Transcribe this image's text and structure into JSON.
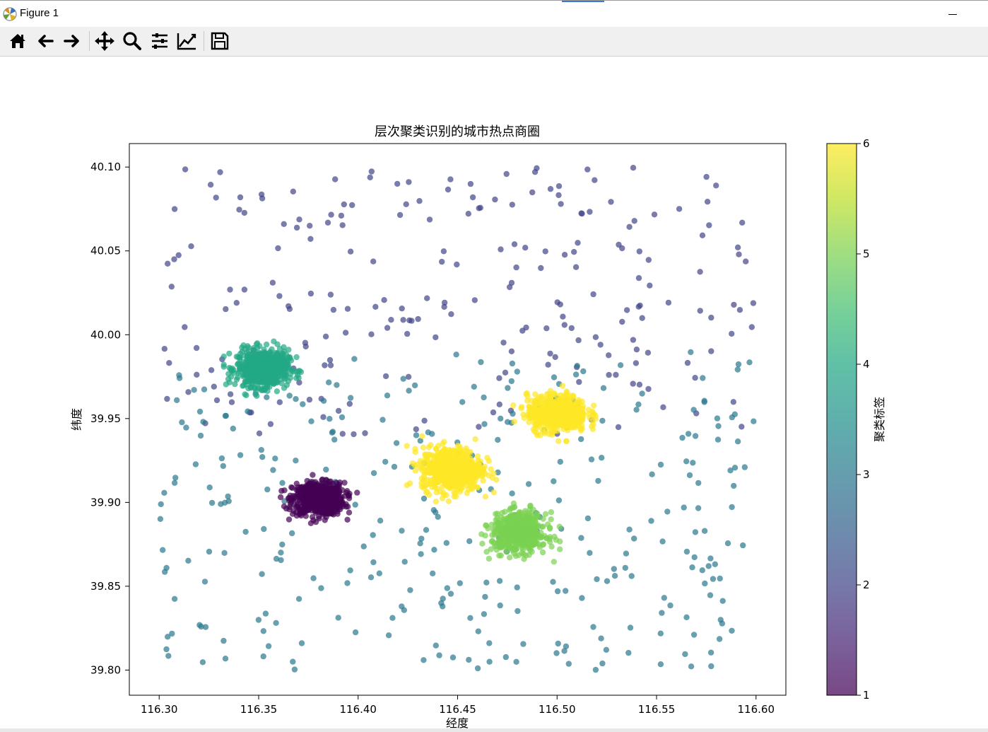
{
  "window": {
    "title": "Figure 1"
  },
  "toolbar": {
    "buttons": [
      {
        "icon": "home-icon"
      },
      {
        "icon": "back-arrow-icon"
      },
      {
        "icon": "forward-arrow-icon"
      },
      {
        "icon": "pan-icon"
      },
      {
        "icon": "zoom-icon"
      },
      {
        "icon": "subplots-config-icon"
      },
      {
        "icon": "edit-axis-icon"
      },
      {
        "icon": "save-icon"
      }
    ]
  },
  "chart_data": {
    "type": "scatter",
    "title": "层次聚类识别的城市热点商圈",
    "xlabel": "经度",
    "ylabel": "纬度",
    "xlim": [
      116.285,
      116.615
    ],
    "ylim": [
      39.785,
      40.114
    ],
    "xticks": [
      116.3,
      116.35,
      116.4,
      116.45,
      116.5,
      116.55,
      116.6
    ],
    "xtick_labels": [
      "116.30",
      "116.35",
      "116.40",
      "116.45",
      "116.50",
      "116.55",
      "116.60"
    ],
    "yticks": [
      39.8,
      39.85,
      39.9,
      39.95,
      40.0,
      40.05,
      40.1
    ],
    "ytick_labels": [
      "39.80",
      "39.85",
      "39.90",
      "39.95",
      "40.00",
      "40.05",
      "40.10"
    ],
    "colorbar": {
      "label": "聚类标签",
      "range": [
        1,
        6
      ],
      "ticks": [
        1,
        2,
        3,
        4,
        5,
        6
      ],
      "tick_labels": [
        "1",
        "2",
        "3",
        "4",
        "5",
        "6"
      ],
      "colormap": "viridis"
    },
    "point_alpha": 0.7,
    "colors": {
      "1": "#440154",
      "2": "#414487",
      "3": "#2a788e",
      "4": "#22a884",
      "5": "#7ad151",
      "6": "#fde725"
    },
    "clusters": [
      {
        "label": 1,
        "center": [
          116.38,
          39.902
        ],
        "sd": [
          0.0065,
          0.0048
        ],
        "count": 650
      },
      {
        "label": 4,
        "center": [
          116.352,
          39.98
        ],
        "sd": [
          0.0065,
          0.0055
        ],
        "count": 650
      },
      {
        "label": 6,
        "center": [
          116.447,
          39.92
        ],
        "sd": [
          0.0075,
          0.0065
        ],
        "count": 650
      },
      {
        "label": 6,
        "center": [
          116.5,
          39.953
        ],
        "sd": [
          0.0075,
          0.0055
        ],
        "count": 550
      },
      {
        "label": 5,
        "center": [
          116.481,
          39.882
        ],
        "sd": [
          0.0068,
          0.0058
        ],
        "count": 550
      }
    ],
    "background_noise": [
      {
        "label": 2,
        "xrange": [
          116.3,
          116.6
        ],
        "yrange": [
          39.94,
          40.1
        ],
        "count": 230
      },
      {
        "label": 3,
        "xrange": [
          116.3,
          116.6
        ],
        "yrange": [
          39.8,
          39.99
        ],
        "count": 330
      }
    ]
  }
}
